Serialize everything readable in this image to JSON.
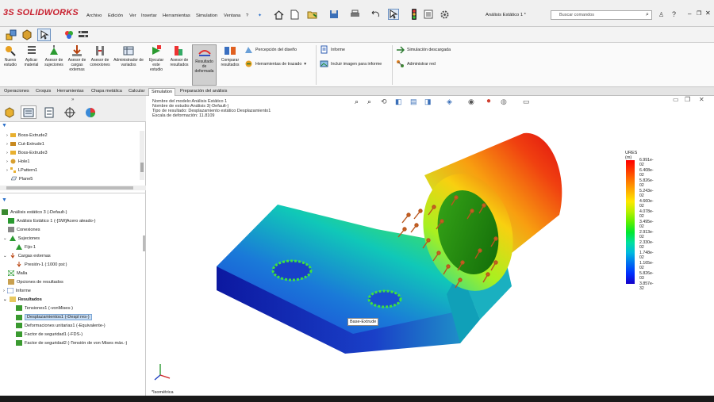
{
  "app": {
    "logo_prefix": "3S",
    "logo_name": "SOLIDWORKS"
  },
  "menu": [
    "Archivo",
    "Edición",
    "Ver",
    "Insertar",
    "Herramientas",
    "Simulation",
    "Ventana",
    "?"
  ],
  "document_title": "Análisis Estático 1 *",
  "search": {
    "placeholder": "Buscar comandos"
  },
  "ribbon": {
    "new_study": "Nuevo estudio",
    "apply_material": "Aplicar material",
    "fixtures_advisor": "Asesor de sujeciones",
    "loads_advisor": "Asesor de cargas externas",
    "connections_advisor": "Asesor de conexiones",
    "variants_manager": "Administrador de variados",
    "run_study": "Ejecutar este estudio",
    "results_advisor": "Asesor de resultados",
    "deformed_result": "Resultado de deformada",
    "compare_results": "Comparar resultados",
    "design_insight": "Percepción del diseño",
    "plot_tools": "Herramientas de trazado",
    "report": "Informe",
    "include_image": "Incluir imagen para informe",
    "offload_simulation": "Simulación descargada",
    "manage_network": "Administrar red"
  },
  "tabs": [
    "Operaciones",
    "Croquis",
    "Herramientas",
    "Chapa metálica",
    "Calcular",
    "Simulation",
    "Preparación del análisis"
  ],
  "active_tab": "Simulation",
  "feature_tree": [
    "Boss-Extrude2",
    "Cut-Extrude1",
    "Boss-Extrude3",
    "Hole1",
    "LPattern1",
    "Plane5"
  ],
  "study_tree": {
    "root": "Análisis estático 3 (-Default-)",
    "items": [
      "Análisis Estático 1 (-[SW]Acero aleado-)",
      "Conexiones",
      "Sujeciones",
      "Fijo-1",
      "Cargas externas",
      "Presión-1 (:1000 psi:)",
      "Malla",
      "Opciones de resultados",
      "Informe",
      "Resultados",
      "Tensiones1 (-vonMises-)",
      "Desplazamientos1 (-Despl res-)",
      "Deformaciones unitarias1 (-Equivalente-)",
      "Factor de seguridad1 (-FDS-)",
      "Factor de seguridad2 (-Tensión de von Mises máx.-)"
    ]
  },
  "model_info": [
    "Nombre del modelo:Análisis Estático 1",
    "Nombre de estudio:Análisis 3(-Default-)",
    "Tipo de resultado: Desplazamiento estático Desplazamiento1",
    "Escala de deformación: 11.8109"
  ],
  "tooltip": "Base-Extrude",
  "view_label": "*Isométrica",
  "legend": {
    "title": "URES (m)",
    "values": [
      "6.991e-02",
      "6.408e-02",
      "5.826e-02",
      "5.243e-02",
      "4.660e-02",
      "4.078e-02",
      "3.495e-02",
      "2.913e-02",
      "2.330e-02",
      "1.748e-02",
      "1.165e-02",
      "5.826e-03",
      "3.857e-32"
    ],
    "colors": [
      "#ff0000",
      "#ff3a00",
      "#ff7700",
      "#ffb000",
      "#ffe800",
      "#b8f000",
      "#5cf000",
      "#00e830",
      "#00e0a0",
      "#00b8e0",
      "#0070f0",
      "#0030ff",
      "#1400c8"
    ]
  },
  "colors": {
    "accent_red": "#c8202f",
    "selection": "#c7dcf3"
  }
}
